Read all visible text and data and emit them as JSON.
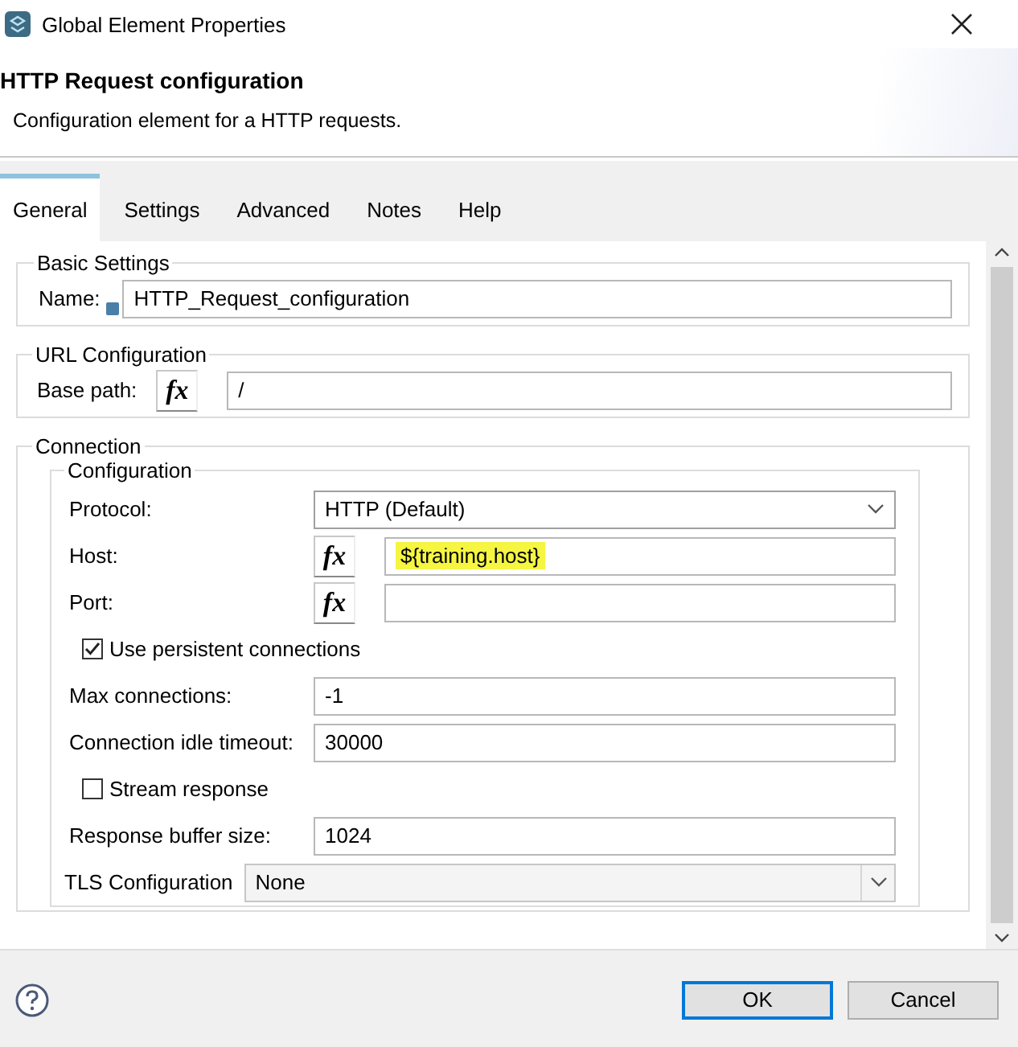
{
  "window": {
    "title": "Global Element Properties"
  },
  "header": {
    "title": "HTTP Request configuration",
    "description": "Configuration element for a HTTP requests."
  },
  "tabs": [
    {
      "label": "General",
      "selected": true
    },
    {
      "label": "Settings",
      "selected": false
    },
    {
      "label": "Advanced",
      "selected": false
    },
    {
      "label": "Notes",
      "selected": false
    },
    {
      "label": "Help",
      "selected": false
    }
  ],
  "sections": [
    {
      "legend": "Basic Settings",
      "rows": [
        {
          "kind": "text",
          "label": "Name:",
          "value": "HTTP_Request_configuration",
          "info_icon": true
        }
      ]
    },
    {
      "legend": "URL Configuration",
      "rows": [
        {
          "kind": "expression",
          "label": "Base path:",
          "button": "fx",
          "value": "/",
          "highlighted": false
        }
      ]
    },
    {
      "legend": "Connection",
      "groups": [
        {
          "legend": "Configuration",
          "rows": [
            {
              "kind": "select",
              "label": "Protocol:",
              "value": "HTTP (Default)"
            },
            {
              "kind": "expression",
              "label": "Host:",
              "button": "fx",
              "value": "${training.host}",
              "highlighted": true
            },
            {
              "kind": "expression",
              "label": "Port:",
              "button": "fx",
              "highlighted": false
            },
            {
              "kind": "checkbox",
              "label": "Use persistent connections",
              "checked": true
            },
            {
              "kind": "text",
              "label": "Max connections:",
              "value": "-1"
            },
            {
              "kind": "text",
              "label": "Connection idle timeout:",
              "value": "30000"
            },
            {
              "kind": "checkbox",
              "label": "Stream response",
              "checked": false
            },
            {
              "kind": "text",
              "label": "Response buffer size:",
              "value": "1024"
            },
            {
              "kind": "combo",
              "label": "TLS Configuration",
              "value": "None"
            }
          ]
        }
      ]
    }
  ],
  "buttons": [
    {
      "label": "OK",
      "default": true
    },
    {
      "label": "Cancel",
      "default": false
    }
  ]
}
